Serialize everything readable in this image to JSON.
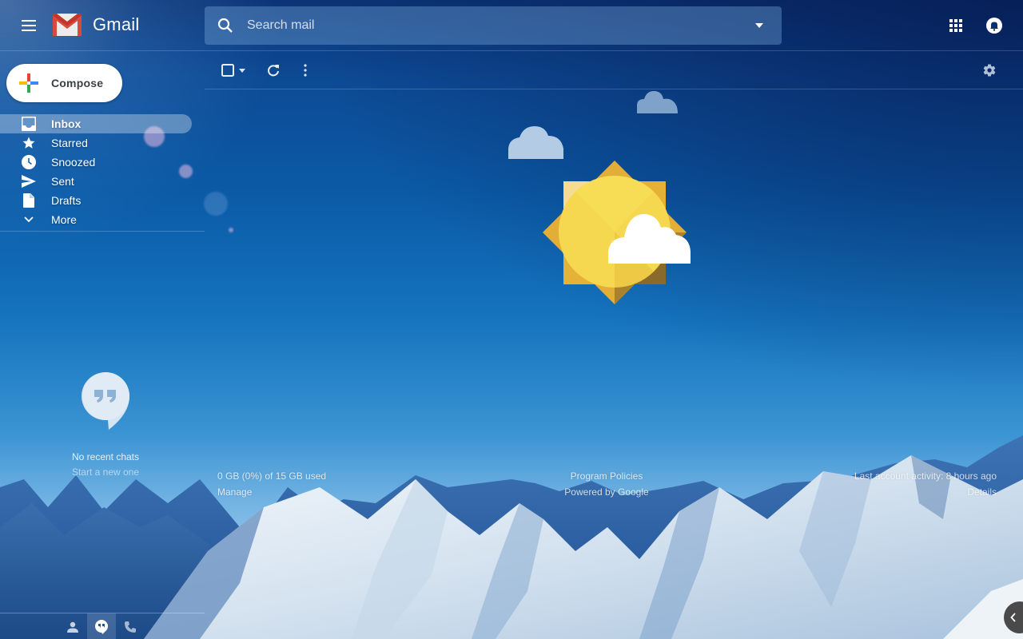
{
  "app": {
    "name": "Gmail",
    "accent_colors": {
      "red": "#ea4335",
      "blue": "#4285f4",
      "green": "#34a853",
      "yellow": "#fbbc04"
    }
  },
  "header": {
    "menu_icon": "hamburger-menu-icon",
    "logo_text": "Gmail",
    "search": {
      "placeholder": "Search mail",
      "value": ""
    },
    "search_options_icon": "caret-down-icon",
    "apps_icon": "apps-grid-icon",
    "notifications_icon": "bell-icon"
  },
  "sidebar": {
    "compose_label": "Compose",
    "items": [
      {
        "label": "Inbox",
        "icon": "inbox-icon",
        "active": true
      },
      {
        "label": "Starred",
        "icon": "star-icon",
        "active": false
      },
      {
        "label": "Snoozed",
        "icon": "clock-icon",
        "active": false
      },
      {
        "label": "Sent",
        "icon": "send-icon",
        "active": false
      },
      {
        "label": "Drafts",
        "icon": "draft-icon",
        "active": false
      },
      {
        "label": "More",
        "icon": "chevron-down-icon",
        "active": false
      }
    ],
    "chat": {
      "empty_title": "No recent chats",
      "empty_action": "Start a new one",
      "tabs": [
        {
          "icon": "contacts-icon",
          "active": false
        },
        {
          "icon": "hangouts-icon",
          "active": true
        },
        {
          "icon": "phone-icon",
          "active": false
        }
      ]
    }
  },
  "toolbar": {
    "select_icon": "checkbox-icon",
    "select_menu_icon": "caret-down-icon",
    "refresh_icon": "refresh-icon",
    "more_icon": "more-vert-icon",
    "settings_icon": "gear-icon"
  },
  "footer": {
    "storage": "0 GB (0%) of 15 GB used",
    "manage": "Manage",
    "program_policies": "Program Policies",
    "powered_by": "Powered by Google",
    "last_activity": "Last account activity: 8 hours ago",
    "details": "Details"
  },
  "side_panel_toggle_icon": "chevron-left-icon"
}
